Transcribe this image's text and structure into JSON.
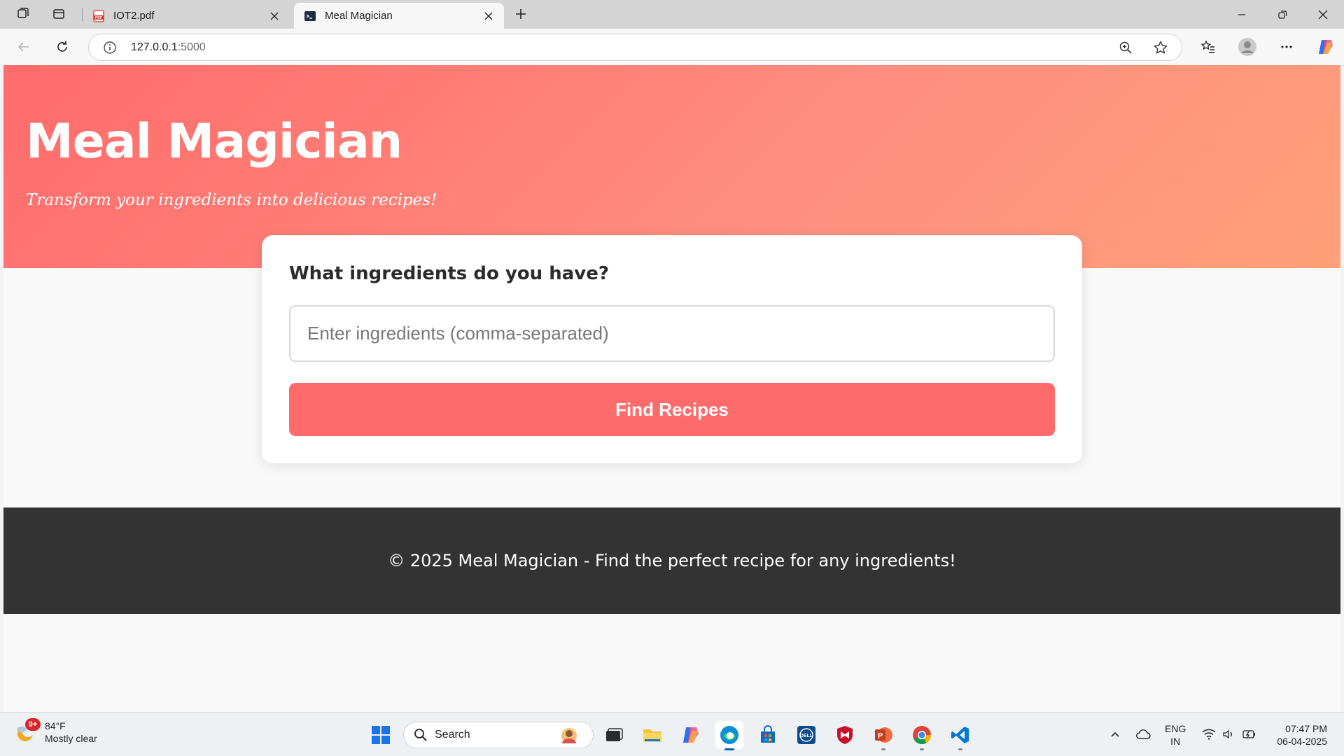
{
  "browser": {
    "tabs": [
      {
        "title": "IOT2.pdf",
        "favicon": "pdf-icon"
      },
      {
        "title": "Meal Magician",
        "favicon": "terminal-icon"
      }
    ],
    "address": {
      "host": "127.0.0.1",
      "port": ":5000"
    }
  },
  "page": {
    "title": "Meal Magician",
    "tagline": "Transform your ingredients into delicious recipes!",
    "form": {
      "heading": "What ingredients do you have?",
      "ingredients_placeholder": "Enter ingredients (comma-separated)",
      "ingredients_value": "",
      "submit_label": "Find Recipes"
    },
    "footer": "© 2025 Meal Magician - Find the perfect recipe for any ingredients!"
  },
  "colors": {
    "accent": "#ff6b6b",
    "hero_gradient_end": "#ffa07a",
    "footer_bg": "#333333"
  },
  "taskbar": {
    "weather": {
      "badge": "9+",
      "temp": "84°F",
      "condition": "Mostly clear"
    },
    "search_label": "Search",
    "lang": {
      "line1": "ENG",
      "line2": "IN"
    },
    "clock": {
      "time": "07:47 PM",
      "date": "06-04-2025"
    }
  }
}
